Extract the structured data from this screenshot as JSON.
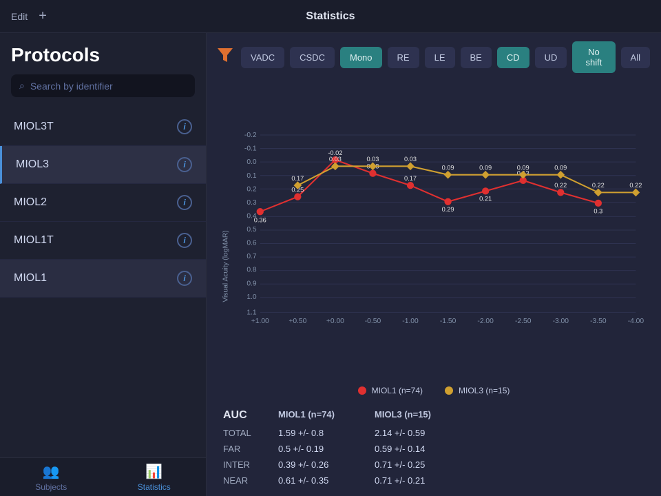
{
  "header": {
    "edit_label": "Edit",
    "statistics_label": "Statistics",
    "add_icon": "+"
  },
  "sidebar": {
    "title": "Protocols",
    "search_placeholder": "Search by identifier",
    "protocols": [
      {
        "name": "MIOL3T",
        "active": false
      },
      {
        "name": "MIOL3",
        "active": true
      },
      {
        "name": "MIOL2",
        "active": false
      },
      {
        "name": "MIOL1T",
        "active": false
      },
      {
        "name": "MIOL1",
        "active": false
      }
    ]
  },
  "filter_bar": {
    "buttons": [
      {
        "label": "VADC",
        "active": false
      },
      {
        "label": "CSDC",
        "active": false
      },
      {
        "label": "Mono",
        "active": true
      },
      {
        "label": "RE",
        "active": false
      },
      {
        "label": "LE",
        "active": false
      },
      {
        "label": "BE",
        "active": false
      },
      {
        "label": "CD",
        "active": true
      },
      {
        "label": "UD",
        "active": false
      },
      {
        "label": "No shift",
        "active": true
      },
      {
        "label": "All",
        "active": false
      }
    ]
  },
  "chart": {
    "y_axis_label": "Visual Acuity (logMAR)",
    "x_axis_label": "",
    "x_ticks": [
      "+1.00",
      "+0.50",
      "+0.00",
      "-0.50",
      "-1.00",
      "-1.50",
      "-2.00",
      "-2.50",
      "-3.00",
      "-3.50",
      "-4.00"
    ],
    "y_ticks": [
      "-0.2",
      "-0.1",
      "0.0",
      "0.1",
      "0.2",
      "0.3",
      "0.4",
      "0.5",
      "0.6",
      "0.7",
      "0.8",
      "0.9",
      "1.0",
      "1.1"
    ],
    "series_miol1": {
      "label": "MIOL1 (n=74)",
      "color": "#e03030",
      "points": [
        {
          "x": "+1.00",
          "y": 0.36,
          "label": "0.36"
        },
        {
          "x": "+0.50",
          "y": 0.25,
          "label": "0.25"
        },
        {
          "x": "+0.00",
          "y": -0.02,
          "label": "-0.02"
        },
        {
          "x": "-0.50",
          "y": 0.08,
          "label": "0.08"
        },
        {
          "x": "-1.00",
          "y": 0.17,
          "label": "0.17"
        },
        {
          "x": "-1.50",
          "y": 0.29,
          "label": "0.29"
        },
        {
          "x": "-2.00",
          "y": 0.21,
          "label": "0.21"
        },
        {
          "x": "-2.50",
          "y": 0.13,
          "label": "0.13"
        },
        {
          "x": "-3.00",
          "y": 0.22,
          "label": "0.22"
        },
        {
          "x": "-3.50",
          "y": 0.3,
          "label": "0.3"
        }
      ]
    },
    "series_miol3": {
      "label": "MIOL3 (n=15)",
      "color": "#d0a030",
      "points": [
        {
          "x": "+0.50",
          "y": 0.17,
          "label": "0.17"
        },
        {
          "x": "+0.00",
          "y": 0.03,
          "label": "0.03"
        },
        {
          "x": "-0.50",
          "y": 0.03,
          "label": "0.03"
        },
        {
          "x": "-1.00",
          "y": 0.03,
          "label": "0.03"
        },
        {
          "x": "-1.50",
          "y": 0.09,
          "label": "0.09"
        },
        {
          "x": "-2.00",
          "y": 0.09,
          "label": "0.09"
        },
        {
          "x": "-2.50",
          "y": 0.09,
          "label": "0.09"
        },
        {
          "x": "-3.00",
          "y": 0.09,
          "label": "0.09"
        },
        {
          "x": "-3.50",
          "y": 0.22,
          "label": "0.22"
        },
        {
          "x": "-4.00",
          "y": 0.22,
          "label": "0.22"
        }
      ]
    }
  },
  "legend": {
    "miol1_label": "MIOL1 (n=74)",
    "miol3_label": "MIOL3 (n=15)"
  },
  "auc_table": {
    "title": "AUC",
    "col1_header": "MIOL1 (n=74)",
    "col2_header": "MIOL3 (n=15)",
    "rows": [
      {
        "label": "TOTAL",
        "val1": "1.59 +/- 0.8",
        "val2": "2.14 +/- 0.59"
      },
      {
        "label": "FAR",
        "val1": "0.5 +/- 0.19",
        "val2": "0.59 +/- 0.14"
      },
      {
        "label": "INTER",
        "val1": "0.39 +/- 0.26",
        "val2": "0.71 +/- 0.25"
      },
      {
        "label": "NEAR",
        "val1": "0.61 +/- 0.35",
        "val2": "0.71 +/- 0.21"
      }
    ]
  },
  "bottom_nav": {
    "subjects_label": "Subjects",
    "statistics_label": "Statistics"
  }
}
